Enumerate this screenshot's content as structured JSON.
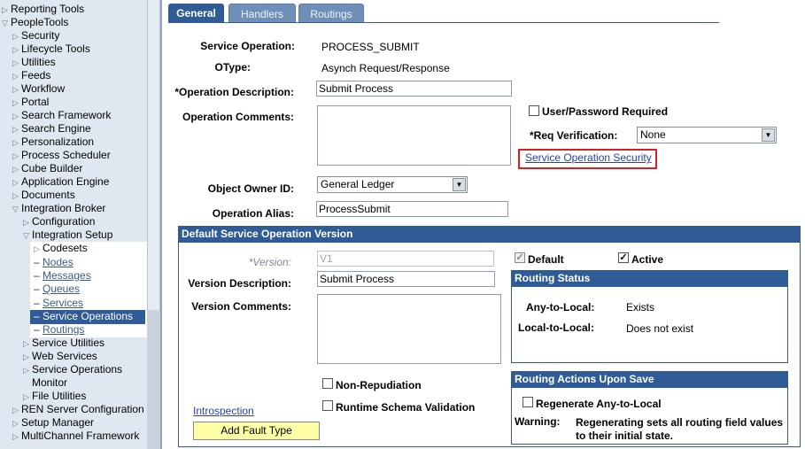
{
  "nav": {
    "items": [
      {
        "label": "Reporting Tools",
        "indent": 0,
        "tri": "closed"
      },
      {
        "label": "PeopleTools",
        "indent": 0,
        "tri": "open"
      },
      {
        "label": "Security",
        "indent": 1,
        "tri": "closed"
      },
      {
        "label": "Lifecycle Tools",
        "indent": 1,
        "tri": "closed"
      },
      {
        "label": "Utilities",
        "indent": 1,
        "tri": "closed"
      },
      {
        "label": "Feeds",
        "indent": 1,
        "tri": "closed"
      },
      {
        "label": "Workflow",
        "indent": 1,
        "tri": "closed"
      },
      {
        "label": "Portal",
        "indent": 1,
        "tri": "closed"
      },
      {
        "label": "Search Framework",
        "indent": 1,
        "tri": "closed"
      },
      {
        "label": "Search Engine",
        "indent": 1,
        "tri": "closed"
      },
      {
        "label": "Personalization",
        "indent": 1,
        "tri": "closed"
      },
      {
        "label": "Process Scheduler",
        "indent": 1,
        "tri": "closed"
      },
      {
        "label": "Cube Builder",
        "indent": 1,
        "tri": "closed"
      },
      {
        "label": "Application Engine",
        "indent": 1,
        "tri": "closed"
      },
      {
        "label": "Documents",
        "indent": 1,
        "tri": "closed"
      },
      {
        "label": "Integration Broker",
        "indent": 1,
        "tri": "open"
      },
      {
        "label": "Configuration",
        "indent": 2,
        "tri": "closed"
      },
      {
        "label": "Integration Setup",
        "indent": 2,
        "tri": "open"
      },
      {
        "label": "Codesets",
        "indent": 3,
        "tri": "closed"
      },
      {
        "label": "Nodes",
        "indent": 3,
        "tri": "link"
      },
      {
        "label": "Messages",
        "indent": 3,
        "tri": "link"
      },
      {
        "label": "Queues",
        "indent": 3,
        "tri": "link"
      },
      {
        "label": "Services",
        "indent": 3,
        "tri": "link"
      },
      {
        "label": "Service Operations",
        "indent": 3,
        "tri": "selected"
      },
      {
        "label": "Routings",
        "indent": 3,
        "tri": "link"
      },
      {
        "label": "Service Utilities",
        "indent": 2,
        "tri": "closed"
      },
      {
        "label": "Web Services",
        "indent": 2,
        "tri": "closed"
      },
      {
        "label": "Service Operations",
        "indent": 2,
        "tri": "closed"
      },
      {
        "label": "Monitor",
        "indent": 2,
        "tri": "none"
      },
      {
        "label": "File Utilities",
        "indent": 2,
        "tri": "closed"
      },
      {
        "label": "REN Server Configuration",
        "indent": 1,
        "tri": "closed"
      },
      {
        "label": "Setup Manager",
        "indent": 1,
        "tri": "closed"
      },
      {
        "label": "MultiChannel Framework",
        "indent": 1,
        "tri": "closed"
      }
    ]
  },
  "tabs": [
    {
      "label": "General",
      "active": true
    },
    {
      "label": "Handlers",
      "active": false
    },
    {
      "label": "Routings",
      "active": false
    }
  ],
  "form": {
    "service_operation_label": "Service Operation:",
    "service_operation_value": "PROCESS_SUBMIT",
    "otype_label": "OType:",
    "otype_value": "Asynch Request/Response",
    "op_desc_label": "*Operation Description:",
    "op_desc_value": "Submit Process",
    "op_comments_label": "Operation Comments:",
    "user_pw_label": "User/Password Required",
    "req_verif_label": "*Req Verification:",
    "req_verif_value": "None",
    "security_link": "Service Operation Security",
    "owner_label": "Object Owner ID:",
    "owner_value": "General Ledger",
    "alias_label": "Operation Alias:",
    "alias_value": "ProcessSubmit"
  },
  "version": {
    "header": "Default Service Operation Version",
    "version_label": "*Version:",
    "version_value": "V1",
    "desc_label": "Version Description:",
    "desc_value": "Submit Process",
    "comments_label": "Version Comments:",
    "default_label": "Default",
    "active_label": "Active",
    "non_repudiation_label": "Non-Repudiation",
    "runtime_schema_label": "Runtime Schema Validation",
    "introspection_link": "Introspection",
    "add_fault_button": "Add Fault Type"
  },
  "routing_status": {
    "header": "Routing Status",
    "any_to_local_label": "Any-to-Local:",
    "any_to_local_value": "Exists",
    "local_to_local_label": "Local-to-Local:",
    "local_to_local_value": "Does not exist"
  },
  "routing_actions": {
    "header": "Routing Actions Upon Save",
    "regenerate_label": "Regenerate Any-to-Local",
    "warning_label": "Warning:",
    "warning_line1": "Regenerating sets all routing field values",
    "warning_line2": "to their initial state."
  },
  "colors": {
    "header_blue": "#2f5b96",
    "nav_bg": "#dfe7f1",
    "highlight_red": "#d92020",
    "button_yellow": "#ffffa8"
  }
}
